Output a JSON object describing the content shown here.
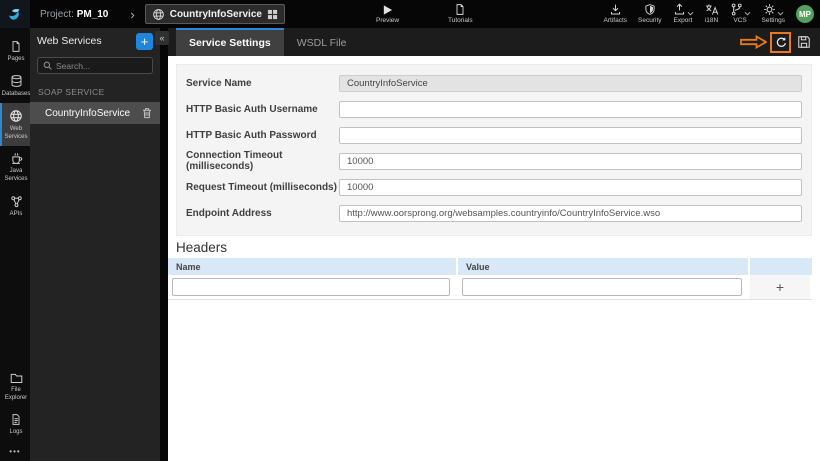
{
  "topbar": {
    "project_label": "Project:",
    "project_name": "PM_10",
    "breadcrumb_chevron": "›",
    "service": {
      "name": "CountryInfoService"
    },
    "preview_label": "Preview",
    "tutorials_label": "Tutorials",
    "menu": {
      "artifacts": "Artifacts",
      "security": "Security",
      "export": "Export",
      "i18n": "i18N",
      "vcs": "VCS",
      "settings": "Settings"
    },
    "avatar_initials": "MP"
  },
  "sidebar": {
    "items": [
      {
        "label": "Pages"
      },
      {
        "label": "Databases"
      },
      {
        "label": "Web Services"
      },
      {
        "label": "Java Services"
      },
      {
        "label": "APIs"
      }
    ],
    "bottom_items": [
      {
        "label": "File Explorer"
      },
      {
        "label": "Logs"
      }
    ],
    "more": "•••"
  },
  "panel": {
    "title": "Web Services",
    "add_button": "+",
    "collapse_button": "«",
    "search_placeholder": "Search...",
    "section_label": "SOAP SERVICE",
    "services": [
      {
        "name": "CountryInfoService"
      }
    ]
  },
  "tabs": [
    {
      "label": "Service Settings"
    },
    {
      "label": "WSDL File"
    }
  ],
  "form": {
    "fields": [
      {
        "label": "Service Name",
        "value": "CountryInfoService"
      },
      {
        "label": "HTTP Basic Auth Username",
        "value": ""
      },
      {
        "label": "HTTP Basic Auth Password",
        "value": ""
      },
      {
        "label": "Connection Timeout (milliseconds)",
        "value": "10000"
      },
      {
        "label": "Request Timeout (milliseconds)",
        "value": "10000"
      },
      {
        "label": "Endpoint Address",
        "value": "http://www.oorsprong.org/websamples.countryinfo/CountryInfoService.wso"
      }
    ]
  },
  "headers_section": {
    "title": "Headers",
    "columns": [
      {
        "label": "Name"
      },
      {
        "label": "Value"
      }
    ],
    "rows": [
      {
        "name": "",
        "value": ""
      }
    ],
    "add_button": "+"
  },
  "colors": {
    "accent_blue": "#2f86d4",
    "annotation_orange": "#e8791e",
    "avatar_green": "#55a05e",
    "table_header_blue": "#d9e8f6"
  }
}
